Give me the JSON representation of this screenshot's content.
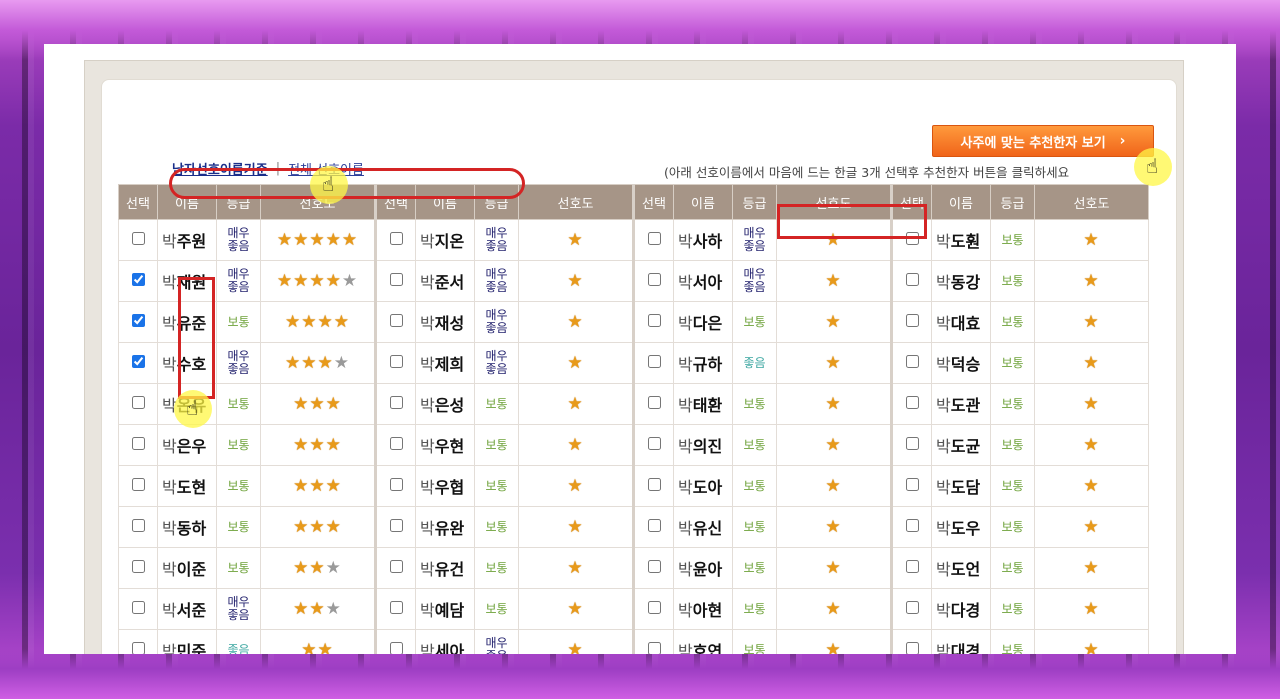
{
  "toolbar": {
    "recommend_label": "사주에 맞는 추천한자 보기",
    "recommend_chevron": "›"
  },
  "tabs": {
    "male_label": "남자선호이름기준",
    "separator": "|",
    "all_label": "전체 선호이름"
  },
  "hint": "(아래 선호이름에서 마음에 드는 한글 3개 선택후 추천한자 버튼을 클릭하세요",
  "headers": [
    "선택",
    "이름",
    "등급",
    "선호도"
  ],
  "surname": "박",
  "grade_labels": {
    "vgood": "매우좋음",
    "good": "좋음",
    "normal": "보통"
  },
  "colors": {
    "header_bg": "#a69587",
    "button_orange": "#f0641a",
    "annotation_red": "#d42424",
    "cursor_yellow": "#fff746"
  },
  "columns": [
    [
      {
        "given": "주원",
        "grade": "vgood",
        "stars": 5,
        "partial": 0,
        "checked": false
      },
      {
        "given": "재원",
        "grade": "vgood",
        "stars": 4,
        "partial": 1,
        "checked": true
      },
      {
        "given": "유준",
        "grade": "normal",
        "stars": 4,
        "partial": 0,
        "checked": true
      },
      {
        "given": "수호",
        "grade": "vgood",
        "stars": 3,
        "partial": 1,
        "checked": true
      },
      {
        "given": "온유",
        "grade": "normal",
        "stars": 3,
        "partial": 0,
        "checked": false
      },
      {
        "given": "은우",
        "grade": "normal",
        "stars": 3,
        "partial": 0,
        "checked": false
      },
      {
        "given": "도현",
        "grade": "normal",
        "stars": 3,
        "partial": 0,
        "checked": false
      },
      {
        "given": "동하",
        "grade": "normal",
        "stars": 3,
        "partial": 0,
        "checked": false
      },
      {
        "given": "이준",
        "grade": "normal",
        "stars": 2,
        "partial": 1,
        "checked": false
      },
      {
        "given": "서준",
        "grade": "vgood",
        "stars": 2,
        "partial": 1,
        "checked": false
      },
      {
        "given": "민준",
        "grade": "good",
        "stars": 2,
        "partial": 0,
        "checked": false
      }
    ],
    [
      {
        "given": "지온",
        "grade": "vgood",
        "stars": 1,
        "partial": 0,
        "checked": false
      },
      {
        "given": "준서",
        "grade": "vgood",
        "stars": 1,
        "partial": 0,
        "checked": false
      },
      {
        "given": "재성",
        "grade": "vgood",
        "stars": 1,
        "partial": 0,
        "checked": false
      },
      {
        "given": "제희",
        "grade": "vgood",
        "stars": 1,
        "partial": 0,
        "checked": false
      },
      {
        "given": "은성",
        "grade": "normal",
        "stars": 1,
        "partial": 0,
        "checked": false
      },
      {
        "given": "우현",
        "grade": "normal",
        "stars": 1,
        "partial": 0,
        "checked": false
      },
      {
        "given": "우협",
        "grade": "normal",
        "stars": 1,
        "partial": 0,
        "checked": false
      },
      {
        "given": "유완",
        "grade": "normal",
        "stars": 1,
        "partial": 0,
        "checked": false
      },
      {
        "given": "유건",
        "grade": "normal",
        "stars": 1,
        "partial": 0,
        "checked": false
      },
      {
        "given": "예담",
        "grade": "normal",
        "stars": 1,
        "partial": 0,
        "checked": false
      },
      {
        "given": "세아",
        "grade": "vgood",
        "stars": 1,
        "partial": 0,
        "checked": false
      }
    ],
    [
      {
        "given": "사하",
        "grade": "vgood",
        "stars": 1,
        "partial": 0,
        "checked": false
      },
      {
        "given": "서아",
        "grade": "vgood",
        "stars": 1,
        "partial": 0,
        "checked": false
      },
      {
        "given": "다은",
        "grade": "normal",
        "stars": 1,
        "partial": 0,
        "checked": false
      },
      {
        "given": "규하",
        "grade": "good",
        "stars": 1,
        "partial": 0,
        "checked": false
      },
      {
        "given": "태환",
        "grade": "normal",
        "stars": 1,
        "partial": 0,
        "checked": false
      },
      {
        "given": "의진",
        "grade": "normal",
        "stars": 1,
        "partial": 0,
        "checked": false
      },
      {
        "given": "도아",
        "grade": "normal",
        "stars": 1,
        "partial": 0,
        "checked": false
      },
      {
        "given": "유신",
        "grade": "normal",
        "stars": 1,
        "partial": 0,
        "checked": false
      },
      {
        "given": "윤아",
        "grade": "normal",
        "stars": 1,
        "partial": 0,
        "checked": false
      },
      {
        "given": "아현",
        "grade": "normal",
        "stars": 1,
        "partial": 0,
        "checked": false
      },
      {
        "given": "호연",
        "grade": "normal",
        "stars": 1,
        "partial": 0,
        "checked": false
      }
    ],
    [
      {
        "given": "도훤",
        "grade": "normal",
        "stars": 1,
        "partial": 0,
        "checked": false
      },
      {
        "given": "동강",
        "grade": "normal",
        "stars": 1,
        "partial": 0,
        "checked": false
      },
      {
        "given": "대효",
        "grade": "normal",
        "stars": 1,
        "partial": 0,
        "checked": false
      },
      {
        "given": "덕승",
        "grade": "normal",
        "stars": 1,
        "partial": 0,
        "checked": false
      },
      {
        "given": "도관",
        "grade": "normal",
        "stars": 1,
        "partial": 0,
        "checked": false
      },
      {
        "given": "도균",
        "grade": "normal",
        "stars": 1,
        "partial": 0,
        "checked": false
      },
      {
        "given": "도담",
        "grade": "normal",
        "stars": 1,
        "partial": 0,
        "checked": false
      },
      {
        "given": "도우",
        "grade": "normal",
        "stars": 1,
        "partial": 0,
        "checked": false
      },
      {
        "given": "도언",
        "grade": "normal",
        "stars": 1,
        "partial": 0,
        "checked": false
      },
      {
        "given": "다경",
        "grade": "normal",
        "stars": 1,
        "partial": 0,
        "checked": false
      },
      {
        "given": "대경",
        "grade": "normal",
        "stars": 1,
        "partial": 0,
        "checked": false
      }
    ]
  ]
}
